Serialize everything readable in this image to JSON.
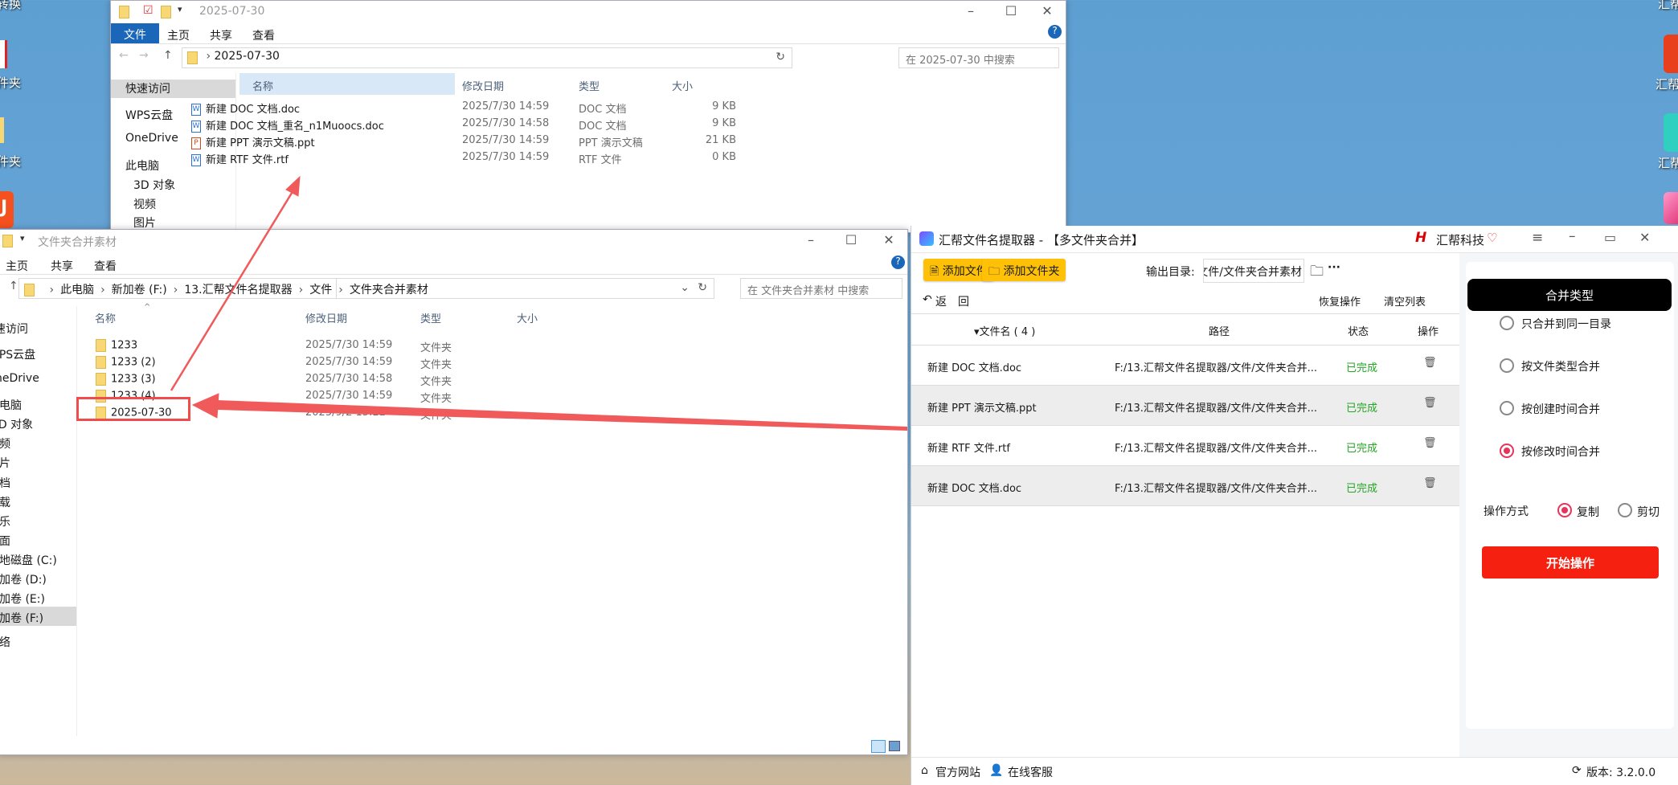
{
  "desktop": {
    "left_labels": [
      "转换",
      "件夹",
      "件夹"
    ],
    "right_labels": [
      "汇帮",
      "汇帮P",
      "汇帮"
    ]
  },
  "win1": {
    "title": "2025-07-30",
    "ribbon": [
      "文件",
      "主页",
      "共享",
      "查看"
    ],
    "path": [
      "2025-07-30"
    ],
    "search_placeholder": "在 2025-07-30 中搜索",
    "sidebar": [
      "快速访问",
      "WPS云盘",
      "OneDrive",
      "此电脑",
      "3D 对象",
      "视频",
      "图片"
    ],
    "columns": [
      "名称",
      "修改日期",
      "类型",
      "大小"
    ],
    "rows": [
      {
        "name": "新建 DOC 文档.doc",
        "date": "2025/7/30 14:59",
        "type": "DOC 文档",
        "size": "9 KB",
        "icon": "W"
      },
      {
        "name": "新建 DOC 文档_重名_n1Muoocs.doc",
        "date": "2025/7/30 14:58",
        "type": "DOC 文档",
        "size": "9 KB",
        "icon": "W"
      },
      {
        "name": "新建 PPT 演示文稿.ppt",
        "date": "2025/7/30 14:59",
        "type": "PPT 演示文稿",
        "size": "21 KB",
        "icon": "P"
      },
      {
        "name": "新建 RTF 文件.rtf",
        "date": "2025/7/30 14:59",
        "type": "RTF 文件",
        "size": "0 KB",
        "icon": "W"
      }
    ]
  },
  "win2": {
    "title": "文件夹合并素材",
    "ribbon": [
      "主页",
      "共享",
      "查看"
    ],
    "path": [
      "此电脑",
      "新加卷 (F:)",
      "13.汇帮文件名提取器",
      "文件",
      "文件夹合并素材"
    ],
    "search_placeholder": "在 文件夹合并素材 中搜索",
    "sidebar": [
      "快速访问",
      "WPS云盘",
      "OneDrive",
      "此电脑",
      "3D 对象",
      "视频",
      "图片",
      "文档",
      "下载",
      "音乐",
      "桌面",
      "本地磁盘 (C:)",
      "新加卷 (D:)",
      "新加卷 (E:)",
      "新加卷 (F:)",
      "网络"
    ],
    "columns": [
      "名称",
      "修改日期",
      "类型",
      "大小"
    ],
    "rows": [
      {
        "name": "1233",
        "date": "2025/7/30 14:59",
        "type": "文件夹"
      },
      {
        "name": "1233 (2)",
        "date": "2025/7/30 14:59",
        "type": "文件夹"
      },
      {
        "name": "1233 (3)",
        "date": "2025/7/30 14:58",
        "type": "文件夹"
      },
      {
        "name": "1233 (4)",
        "date": "2025/7/30 14:59",
        "type": "文件夹"
      },
      {
        "name": "2025-07-30",
        "date": "2025/9/2 15:22",
        "type": "文件夹"
      }
    ]
  },
  "app": {
    "title": "汇帮文件名提取器 - 【多文件夹合并】",
    "brand": "汇帮科技",
    "add_file": "添加文件",
    "add_folder": "添加文件夹",
    "output_label": "输出目录:",
    "output_value": "汇帮文件名提取器/文件/文件夹合并素材",
    "more": "···",
    "back": "返　回",
    "restore": "恢复操作",
    "clear": "清空列表",
    "headers": {
      "name": "▾文件名 ( 4 )",
      "path": "路径",
      "status": "状态",
      "action": "操作"
    },
    "rows": [
      {
        "name": "新建 DOC 文档.doc",
        "path": "F:/13.汇帮文件名提取器/文件/文件夹合并...",
        "status": "已完成"
      },
      {
        "name": "新建 PPT 演示文稿.ppt",
        "path": "F:/13.汇帮文件名提取器/文件/文件夹合并...",
        "status": "已完成"
      },
      {
        "name": "新建 RTF 文件.rtf",
        "path": "F:/13.汇帮文件名提取器/文件/文件夹合并...",
        "status": "已完成"
      },
      {
        "name": "新建 DOC 文档.doc",
        "path": "F:/13.汇帮文件名提取器/文件/文件夹合并...",
        "status": "已完成"
      }
    ],
    "merge_type": "合并类型",
    "options": [
      {
        "label": "只合并到同一目录",
        "selected": false
      },
      {
        "label": "按文件类型合并",
        "selected": false
      },
      {
        "label": "按创建时间合并",
        "selected": false
      },
      {
        "label": "按修改时间合并",
        "selected": true
      }
    ],
    "mode_label": "操作方式",
    "modes": [
      {
        "label": "复制",
        "selected": true
      },
      {
        "label": "剪切",
        "selected": false
      }
    ],
    "start": "开始操作",
    "website": "官方网站",
    "support": "在线客服",
    "version": "版本: 3.2.0.0",
    "colors": {
      "accent_yellow": "#ffc107",
      "start_red": "#f5200f",
      "radio_pink": "#e8335a",
      "done_green": "#23a623"
    }
  }
}
